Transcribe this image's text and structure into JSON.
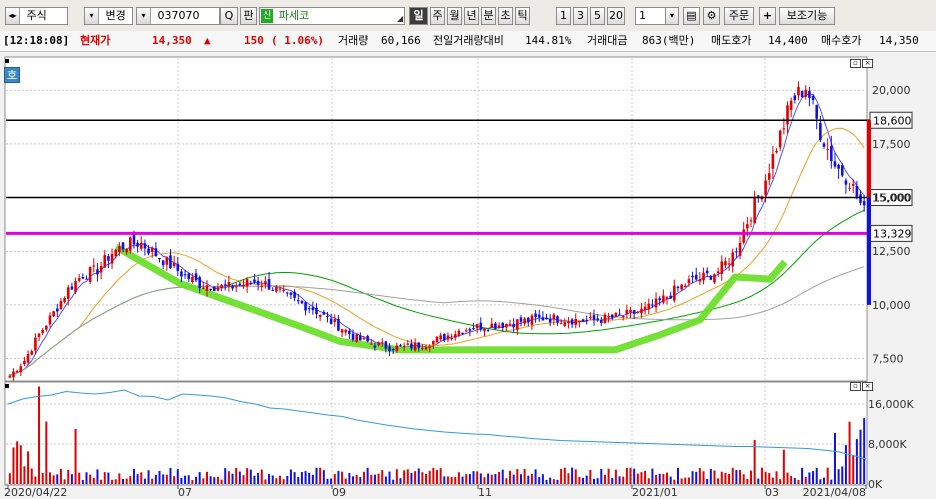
{
  "toolbar": {
    "market": "주식",
    "change": "변경",
    "code": "037070",
    "search_label": "Q",
    "pan_label": "판",
    "new_badge": "신",
    "stock_name": "파세코",
    "periods": [
      "일",
      "주",
      "월",
      "년",
      "분",
      "초",
      "틱"
    ],
    "selected_period": "일",
    "intervals": [
      "1",
      "3",
      "5",
      "20"
    ],
    "count_value": "1",
    "order_label": "주문",
    "plus_label": "+",
    "aux_label": "보조기능"
  },
  "quote": {
    "time": "[12:18:08]",
    "price_label": "현재가",
    "price": "14,350",
    "arrow": "▲",
    "change": "150",
    "change_pct": "( 1.06%)",
    "volume_label": "거래량",
    "volume": "60,166",
    "prev_ratio_label": "전일거래량대비",
    "prev_ratio": "144.81%",
    "amount_label": "거래대금",
    "amount": "863(백만)",
    "ask_label": "매도호가",
    "ask": "14,400",
    "bid_label": "매수호가",
    "bid": "14,350"
  },
  "side_badge": "호",
  "colors": {
    "up": "#e00000",
    "down": "#1010e0",
    "ma5": "#5050ff",
    "ma20": "#f0a020",
    "ma60": "#00a000",
    "ma120": "#a0a0a0",
    "highlight": "#66dd22",
    "magenta": "#e000e0",
    "vol_line": "#3399dd"
  },
  "chart_data": [
    {
      "type": "candlestick",
      "y_ticks": [
        "20,000",
        "17,500",
        "15,000",
        "12,500",
        "10,000",
        "7,500"
      ],
      "ylim": [
        6500,
        21500
      ],
      "x_labels": [
        "2020/04/22",
        "07",
        "09",
        "11",
        "2021/01",
        "03",
        "2021/04/08"
      ],
      "price_lines": [
        {
          "label": "18,600",
          "value": 18600,
          "color": "#000000"
        },
        {
          "label": "15,000",
          "value": 15000,
          "color": "#000000"
        },
        {
          "label": "13,329",
          "value": 13329,
          "color": "#e000e0"
        }
      ],
      "close_approx": [
        6700,
        7400,
        8600,
        9600,
        10700,
        11400,
        11600,
        12400,
        12800,
        12900,
        12400,
        11900,
        11400,
        11000,
        10900,
        10800,
        10950,
        11100,
        10900,
        10400,
        10100,
        9800,
        9300,
        8900,
        8400,
        8200,
        8050,
        8000,
        8100,
        8250,
        8500,
        8800,
        8950,
        9050,
        9100,
        9200,
        9300,
        9400,
        9350,
        9300,
        9250,
        9350,
        9450,
        9600,
        9800,
        10200,
        10700,
        11100,
        11300,
        11600,
        12400,
        14000,
        15500,
        17500,
        19500,
        20200,
        18000,
        16500,
        15800,
        14350
      ]
    },
    {
      "type": "bar",
      "y_ticks": [
        "16,000K",
        "8,000K",
        "0K"
      ],
      "ylim": [
        0,
        20000
      ],
      "volume_line": [
        16000,
        17000,
        17500,
        17800,
        18500,
        18200,
        18000,
        18300,
        18800,
        17600,
        17500,
        16800,
        18000,
        17800,
        17600,
        17200,
        16500,
        16000,
        15200,
        15000,
        14600,
        14200,
        13800,
        13500,
        12800,
        12300,
        11800,
        11400,
        11000,
        10700,
        10400,
        10200,
        10000,
        9900,
        9600,
        9400,
        9100,
        8900,
        8700,
        8600,
        8500,
        8400,
        8300,
        8200,
        8100,
        8000,
        7900,
        7800,
        7700,
        7600,
        7500,
        7500,
        7400,
        7300,
        7200,
        7100,
        6800,
        6500,
        5800,
        5000
      ]
    }
  ]
}
